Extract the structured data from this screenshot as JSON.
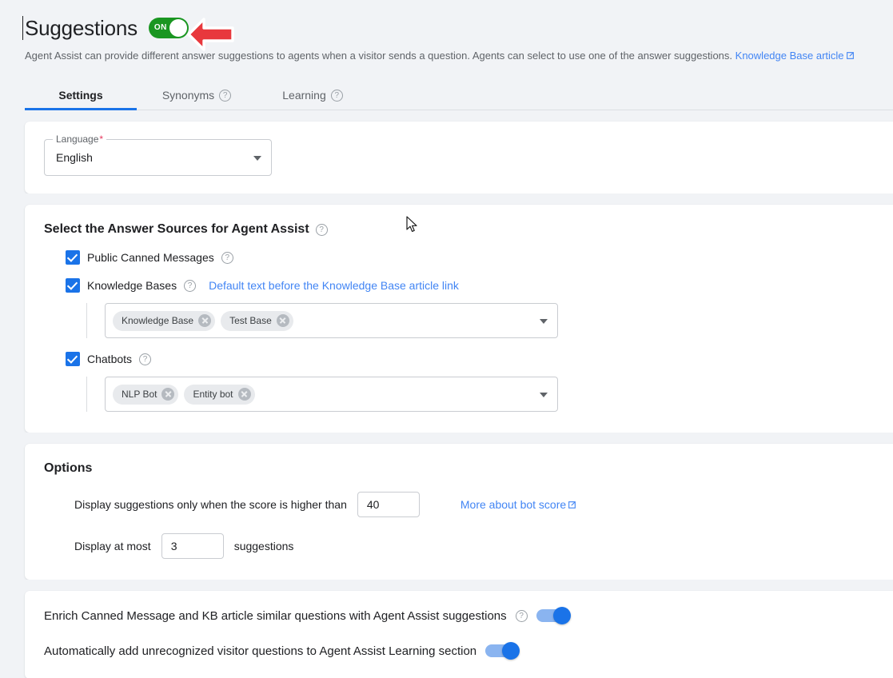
{
  "header": {
    "title": "Suggestions",
    "toggle_label": "ON",
    "toggle_state": "on",
    "description": "Agent Assist can provide different answer suggestions to agents when a visitor sends a question. Agents can select to use one of the answer suggestions.",
    "doc_link": "Knowledge Base article",
    "arrow_annotation_color": "#e8383d"
  },
  "tabs": [
    {
      "label": "Settings",
      "active": true,
      "has_help": false
    },
    {
      "label": "Synonyms",
      "active": false,
      "has_help": true
    },
    {
      "label": "Learning",
      "active": false,
      "has_help": true
    }
  ],
  "language_card": {
    "field_label": "Language",
    "required_marker": "*",
    "value": "English"
  },
  "sources_card": {
    "title": "Select the Answer Sources for Agent Assist",
    "options": [
      {
        "label": "Public Canned Messages",
        "checked": true,
        "has_help": true,
        "link": null,
        "chips": null
      },
      {
        "label": "Knowledge Bases",
        "checked": true,
        "has_help": true,
        "link": "Default text before the Knowledge Base article link",
        "chips": [
          "Knowledge Base",
          "Test Base"
        ]
      },
      {
        "label": "Chatbots",
        "checked": true,
        "has_help": true,
        "link": null,
        "chips": [
          "NLP Bot",
          "Entity bot"
        ]
      }
    ]
  },
  "options_card": {
    "title": "Options",
    "score_label": "Display suggestions only when the score is higher than",
    "score_value": "40",
    "score_link": "More about bot score",
    "count_label_before": "Display at most",
    "count_value": "3",
    "count_label_after": "suggestions"
  },
  "bottom_card": {
    "rows": [
      {
        "label": "Enrich Canned Message and KB article similar questions with Agent Assist suggestions",
        "has_help": true,
        "enabled": true
      },
      {
        "label": "Automatically add unrecognized visitor questions to Agent Assist Learning section",
        "has_help": false,
        "enabled": true
      }
    ]
  },
  "colors": {
    "accent_blue": "#1a73e8",
    "link_blue": "#4285f4",
    "toggle_green": "#1a9621",
    "arrow_red": "#e8383d",
    "page_bg": "#f1f3f6"
  }
}
